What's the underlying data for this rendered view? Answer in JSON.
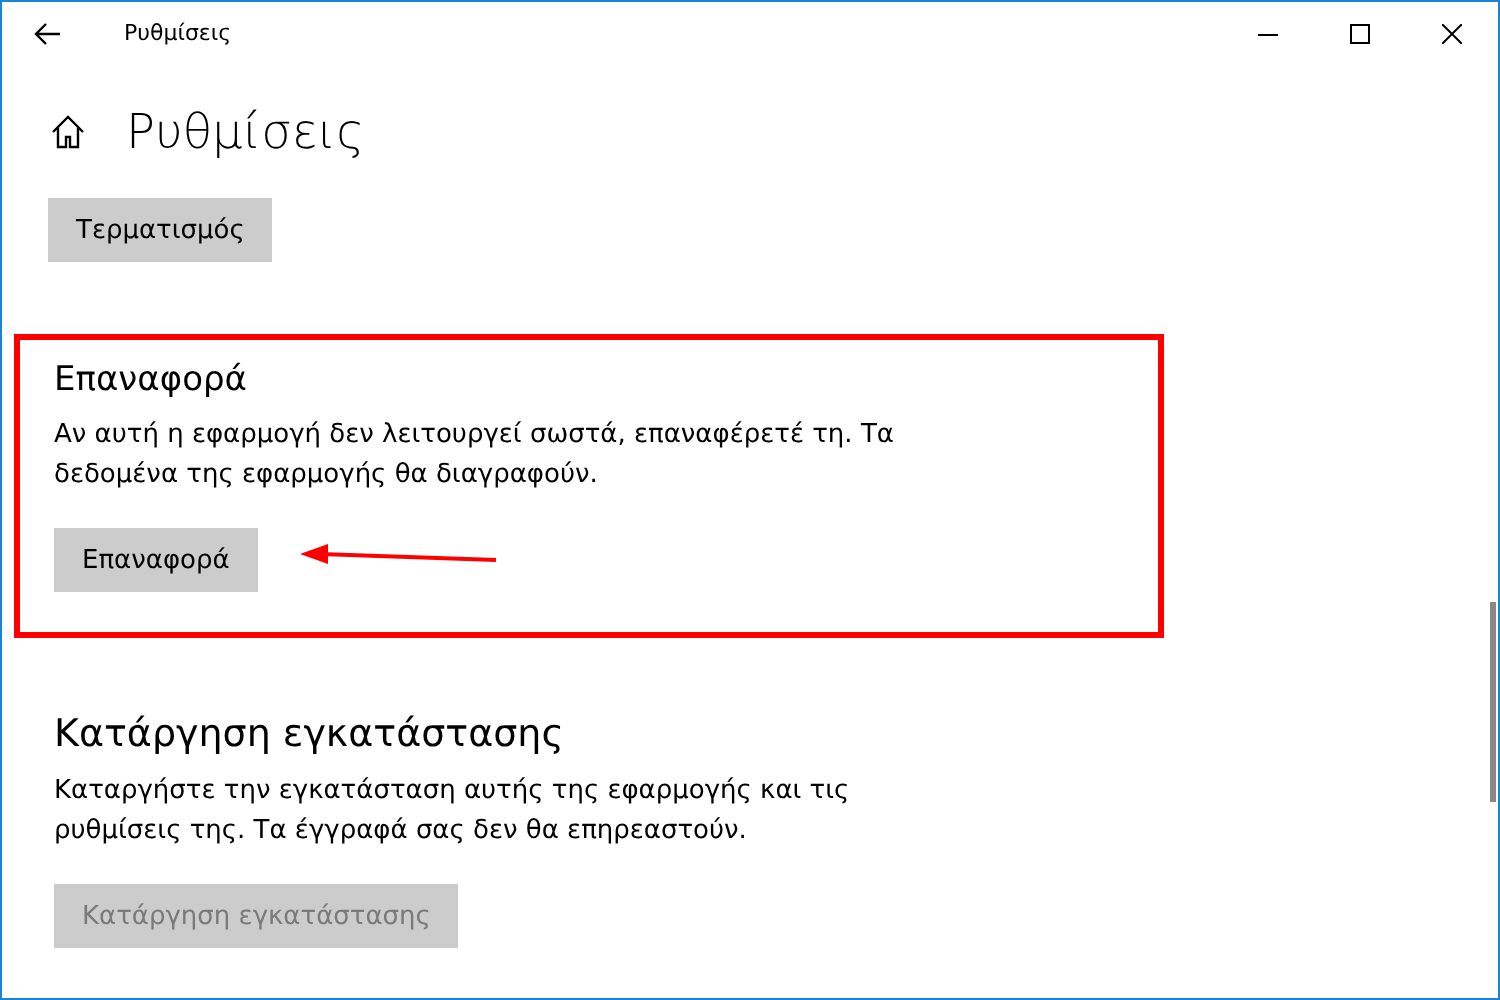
{
  "window": {
    "title": "Ρυθμίσεις"
  },
  "page": {
    "heading": "Ρυθμίσεις"
  },
  "top_button": {
    "label": "Τερματισμός",
    "disabled": false
  },
  "sections": [
    {
      "title": "Επαναφορά",
      "description": "Αν αυτή η εφαρμογή δεν λειτουργεί σωστά, επαναφέρετέ τη. Τα δεδομένα της εφαρμογής θα διαγραφούν.",
      "button": {
        "label": "Επαναφορά",
        "disabled": false
      },
      "highlighted": true
    },
    {
      "title": "Κατάργηση εγκατάστασης",
      "description": "Καταργήστε την εγκατάσταση αυτής της εφαρμογής και τις ρυθμίσεις της. Τα έγγραφά σας δεν θα επηρεαστούν.",
      "button": {
        "label": "Κατάργηση εγκατάστασης",
        "disabled": true
      },
      "highlighted": false
    }
  ]
}
